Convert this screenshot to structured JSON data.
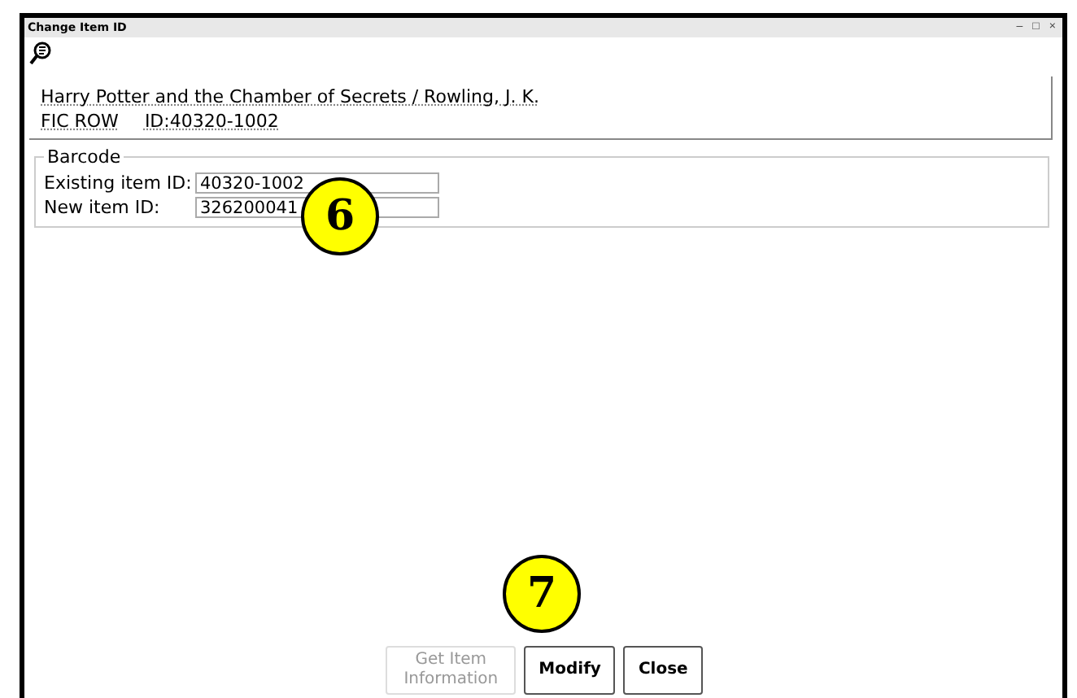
{
  "window": {
    "title": "Change Item ID",
    "controls": [
      "–",
      "□",
      "×"
    ]
  },
  "item": {
    "title": "Harry Potter and the Chamber of Secrets / Rowling, J. K.",
    "call_number": "FIC ROW",
    "id": "ID:40320-1002"
  },
  "barcode": {
    "legend": "Barcode",
    "fields": [
      {
        "label": "Existing item ID:",
        "value": "40320-1002"
      },
      {
        "label": "New item ID:",
        "value": "326200041"
      }
    ]
  },
  "buttons": [
    {
      "label": "Get Item Information",
      "disabled": true
    },
    {
      "label": "Modify",
      "disabled": false
    },
    {
      "label": "Close",
      "disabled": false
    }
  ],
  "callouts": [
    "6",
    "7"
  ]
}
